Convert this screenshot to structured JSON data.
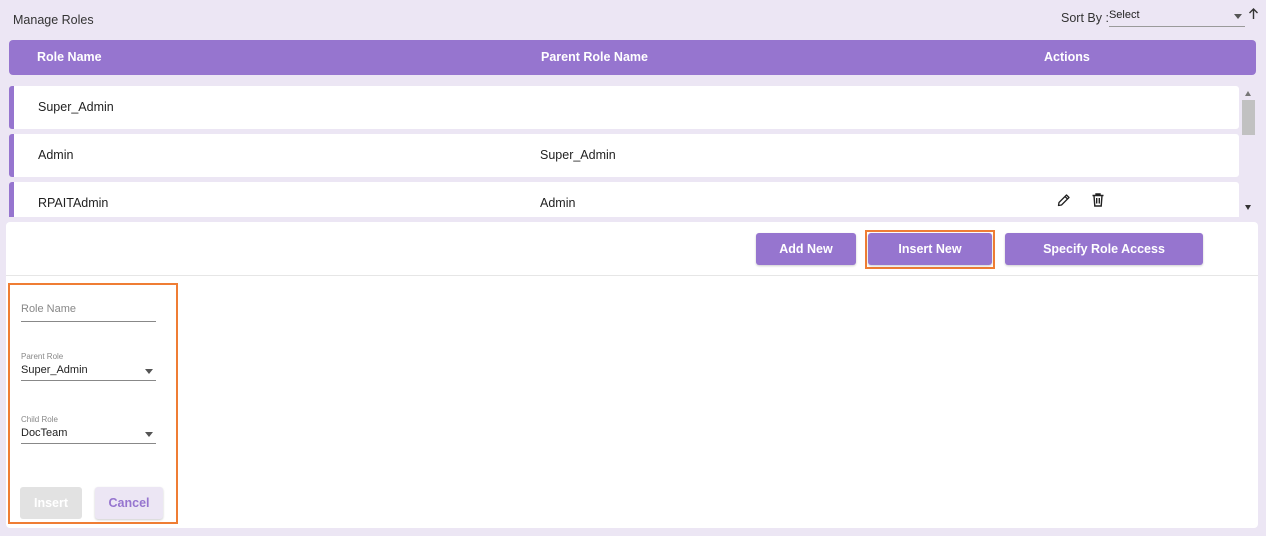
{
  "page": {
    "title": "Manage Roles"
  },
  "sort": {
    "label": "Sort By :",
    "value": "Select"
  },
  "table": {
    "headers": {
      "role_name": "Role Name",
      "parent_role_name": "Parent Role Name",
      "actions": "Actions"
    },
    "rows": [
      {
        "role_name": "Super_Admin",
        "parent_role_name": ""
      },
      {
        "role_name": "Admin",
        "parent_role_name": "Super_Admin"
      },
      {
        "role_name": "RPAITAdmin",
        "parent_role_name": "Admin"
      }
    ]
  },
  "toolbar": {
    "add_new": "Add New",
    "insert_new": "Insert New",
    "specify_role_access": "Specify Role Access"
  },
  "form": {
    "role_name_placeholder": "Role Name",
    "parent_role_label": "Parent Role",
    "parent_role_value": "Super_Admin",
    "child_role_label": "Child Role",
    "child_role_value": "DocTeam",
    "insert_label": "Insert",
    "cancel_label": "Cancel"
  },
  "colors": {
    "accent": "#9675cf",
    "highlight": "#ef7d34",
    "background": "#ece6f4"
  },
  "icons": {
    "edit": "pencil-icon",
    "delete": "trash-icon",
    "sort_direction": "arrow-up-icon"
  }
}
